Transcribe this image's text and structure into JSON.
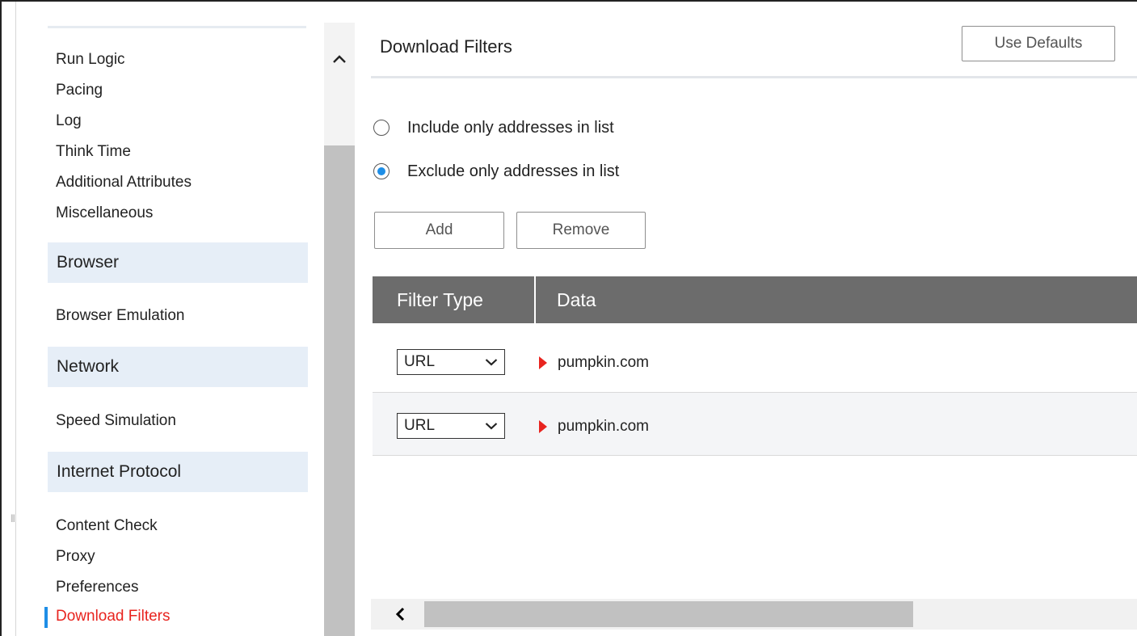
{
  "sidebar": {
    "items_top": [
      {
        "label": "Run Logic"
      },
      {
        "label": "Pacing"
      },
      {
        "label": "Log"
      },
      {
        "label": "Think Time"
      },
      {
        "label": "Additional Attributes"
      },
      {
        "label": "Miscellaneous"
      }
    ],
    "browser_header": "Browser",
    "browser_emulation": "Browser Emulation",
    "network_header": "Network",
    "speed_simulation": "Speed Simulation",
    "internet_protocol_header": "Internet Protocol",
    "items_bottom": [
      {
        "label": "Content Check"
      },
      {
        "label": "Proxy"
      },
      {
        "label": "Preferences"
      },
      {
        "label": "Download Filters"
      }
    ],
    "active_item": "Download Filters",
    "active_color": "#e8241f"
  },
  "main": {
    "title": "Download Filters",
    "use_defaults_label": "Use Defaults",
    "radios": [
      {
        "label": "Include only addresses in list",
        "checked": false
      },
      {
        "label": "Exclude only addresses in list",
        "checked": true
      }
    ],
    "add_label": "Add",
    "remove_label": "Remove",
    "columns": [
      "Filter Type",
      "Data"
    ],
    "rows": [
      {
        "filter_type": "URL",
        "data": "pumpkin.com"
      },
      {
        "filter_type": "URL",
        "data": "pumpkin.com"
      }
    ]
  },
  "icons": {
    "scroll_up": "chevron-up-icon",
    "scroll_left": "chevron-left-icon",
    "dropdown": "chevron-down-icon",
    "row_marker": "red-triangle-icon",
    "splitter": "grip-icon"
  },
  "colors": {
    "accent": "#1e8ee6",
    "error_red": "#e8241f",
    "grid_header": "#6c6c6c",
    "section_header_bg": "#e6eef7"
  }
}
